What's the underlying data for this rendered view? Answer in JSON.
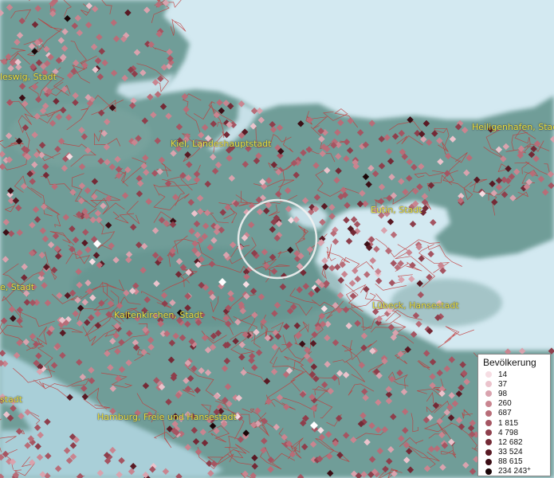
{
  "map": {
    "colors": {
      "sea": "#d3e9f1",
      "land": "#6f9d98",
      "borders": "#c23a3a",
      "highlight_ring": "#f2f2f2",
      "place_label": "#e8e040"
    },
    "places": [
      {
        "name": "leswig, Stadt"
      },
      {
        "name": "Kiel, Landeshauptstadt"
      },
      {
        "name": "Heiligenhafen, Stadt"
      },
      {
        "name": "Eutin, Stadt"
      },
      {
        "name": "e, Stadt"
      },
      {
        "name": "Lübeck, Hansestadt"
      },
      {
        "name": "Kaltenkirchen, Stadt"
      },
      {
        "name": "stadt"
      },
      {
        "name": "Hamburg, Freie und Hansestadt"
      }
    ]
  },
  "legend": {
    "title": "Bevölkerung",
    "entries": [
      {
        "label": "14",
        "color": "#f6dde3"
      },
      {
        "label": "37",
        "color": "#ebc3cc"
      },
      {
        "label": "98",
        "color": "#d9a3ae"
      },
      {
        "label": "260",
        "color": "#c98590"
      },
      {
        "label": "687",
        "color": "#b86d78"
      },
      {
        "label": "1 815",
        "color": "#a55562"
      },
      {
        "label": "4 798",
        "color": "#8e3f4c"
      },
      {
        "label": "12 682",
        "color": "#742a36"
      },
      {
        "label": "33 524",
        "color": "#591a24"
      },
      {
        "label": "88 615",
        "color": "#3c0f16"
      },
      {
        "label": "234 243",
        "color": "#1a0507",
        "suffix": "+"
      }
    ]
  }
}
